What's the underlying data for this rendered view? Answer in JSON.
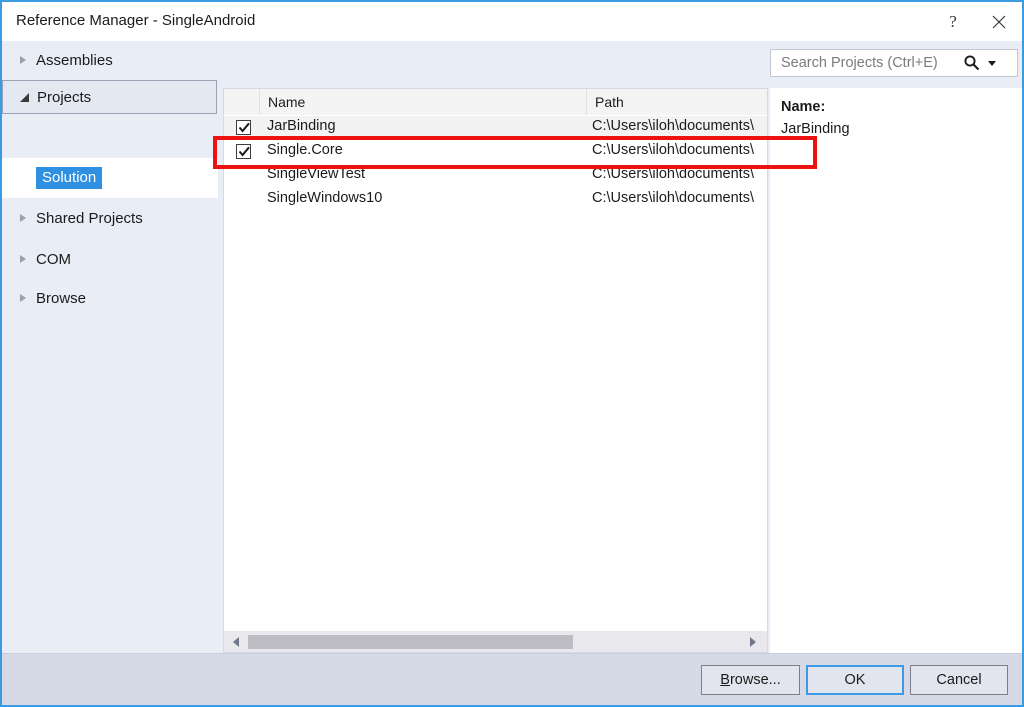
{
  "window": {
    "title": "Reference Manager - SingleAndroid",
    "help_icon": "question-mark-icon",
    "help_label": "?",
    "close_label": "✕",
    "accent_color": "#3b9ae1"
  },
  "sidebar": {
    "items": [
      {
        "label": "Assemblies",
        "expanded": false,
        "selected": false
      },
      {
        "label": "Projects",
        "expanded": true,
        "selected": true
      },
      {
        "label": "Shared Projects",
        "expanded": false,
        "selected": false
      },
      {
        "label": "COM",
        "expanded": false,
        "selected": false
      },
      {
        "label": "Browse",
        "expanded": false,
        "selected": false
      }
    ],
    "sub_item": {
      "label": "Solution",
      "selected": true,
      "highlight_color": "#2f8fe0"
    }
  },
  "search": {
    "placeholder": "Search Projects (Ctrl+E)",
    "value": "",
    "icon": "search-icon",
    "dropdown_icon": "chevron-down-icon"
  },
  "list": {
    "columns": [
      "",
      "Name",
      "Path"
    ],
    "rows": [
      {
        "checked": true,
        "name": "JarBinding",
        "path": "C:\\Users\\iloh\\documents\\",
        "highlighted": true
      },
      {
        "checked": true,
        "name": "Single.Core",
        "path": "C:\\Users\\iloh\\documents\\",
        "highlighted": false
      },
      {
        "checked": false,
        "name": "SingleViewTest",
        "path": "C:\\Users\\iloh\\documents\\",
        "highlighted": false
      },
      {
        "checked": false,
        "name": "SingleWindows10",
        "path": "C:\\Users\\iloh\\documents\\",
        "highlighted": false
      }
    ]
  },
  "details": {
    "name_label": "Name:",
    "name_value": "JarBinding"
  },
  "footer": {
    "browse_accel": "B",
    "browse_rest": "rowse...",
    "ok_label": "OK",
    "cancel_label": "Cancel"
  },
  "annotation": {
    "highlight_color": "#ee1111",
    "target_row": "Single.Core"
  }
}
